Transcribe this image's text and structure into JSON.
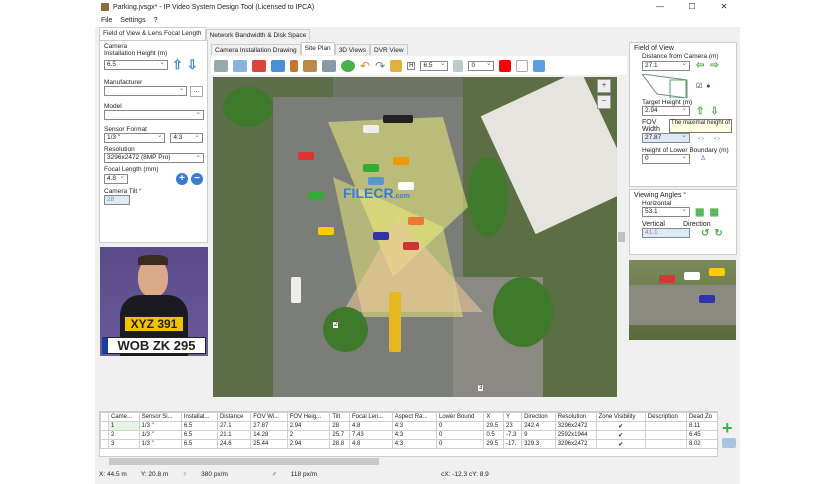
{
  "title": "Parking.jvsgx* - IP Video System Design Tool (Licensed to IPCA)",
  "window_buttons": [
    "—",
    "☐",
    "✕"
  ],
  "menu": [
    "File",
    "Settings",
    "?"
  ],
  "main_tabs": [
    "Field of View & Lens Focal Length",
    "Network Bandwidth & Disk Space"
  ],
  "left": {
    "group": "Camera",
    "installation_height_label": "Installation Height (m)",
    "installation_height": "6.5",
    "manufacturer_label": "Manufacturer",
    "manufacturer": "",
    "more_btn": "...",
    "model_label": "Model",
    "model": "",
    "sensor_label": "Sensor Format",
    "sensor": "1/3 \"",
    "aspect": "4:3",
    "resolution_label": "Resolution",
    "resolution": "3296x2472 (8MP Pro)",
    "focal_label": "Focal Length (mm)",
    "focal": "4.8",
    "tilt_label": "Camera Tilt °",
    "tilt": "28",
    "plates": [
      "XYZ 391",
      "WOB ZK 295"
    ]
  },
  "center": {
    "tabs": [
      "Camera Installation Drawing",
      "Site Plan",
      "3D Views",
      "DVR View"
    ],
    "height_value": "6.5",
    "angle_value": "0",
    "color": "#ff0000",
    "watermark": "FILECR",
    "watermark_sub": ".com",
    "camera_markers": [
      "2",
      "3"
    ]
  },
  "right": {
    "group": "Field of View",
    "distance_label": "Distance from Camera  (m)",
    "distance": "27.1",
    "target_label": "Target Height (m)",
    "target": "2.94",
    "tooltip": "The maximal height of",
    "fov_width_label": "FOV Width",
    "fov_width": "27.87",
    "lower_label": "Height of Lower Boundary (m)",
    "lower": "0",
    "angles_group": "Viewing Angles °",
    "horizontal_label": "Horizontal",
    "horizontal": "53.1",
    "vertical_label": "Vertical",
    "vertical": "41.1",
    "direction_label": "Direction"
  },
  "table": {
    "headers": [
      "Came...",
      "Sensor Si...",
      "Installat...",
      "Distance",
      "FOV Wi...",
      "FOV Heig...",
      "Tilt",
      "Focal Len...",
      "Aspect Ra...",
      "Lower Bound",
      "X",
      "Y",
      "Direction",
      "Resolution",
      "Zone Visibility",
      "Description",
      "Dead Zo"
    ],
    "rows": [
      [
        "1",
        "1/3 \"",
        "6.5",
        "27.1",
        "27.87",
        "2.94",
        "28",
        "4.8",
        "4:3",
        "0",
        "29.5",
        "23",
        "242.4",
        "3296x2472",
        "✔",
        "",
        "8.11"
      ],
      [
        "2",
        "1/3 \"",
        "6.5",
        "21.1",
        "14.28",
        "2",
        "25.7",
        "7.43",
        "4:3",
        "0",
        "0.5",
        "-7.3",
        "9",
        "2592x1944",
        "✔",
        "",
        "6.45"
      ],
      [
        "3",
        "1/3 \"",
        "6.5",
        "24.6",
        "25.44",
        "2.94",
        "28.8",
        "4.8",
        "4:3",
        "0",
        "29.5",
        "-17.",
        "329.3",
        "3296x2472",
        "✔",
        "",
        "8.02"
      ]
    ]
  },
  "status": {
    "x": "X: 44.5 m",
    "y": "Y: 20.8 m",
    "ppm1": "380 px/m",
    "ppm2": "118 px/m",
    "cxy": "cX: -12.3 cY: 8.9"
  }
}
